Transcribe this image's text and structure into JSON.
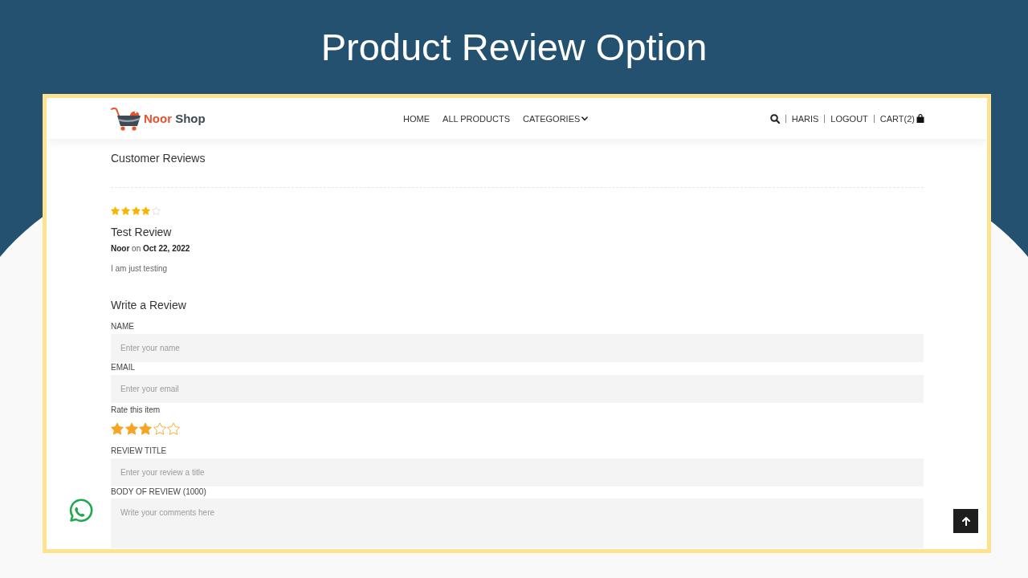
{
  "slide": {
    "title": "Product Review Option"
  },
  "navbar": {
    "brand": {
      "first": "Noor",
      "second": "Shop"
    },
    "menu": [
      {
        "kind": "link",
        "label": "HOME"
      },
      {
        "kind": "link",
        "label": "ALL PRODUCTS"
      },
      {
        "kind": "dropdown",
        "label": "CATEGORIES"
      }
    ],
    "account": [
      {
        "kind": "search"
      },
      {
        "kind": "link",
        "label": "HARIS"
      },
      {
        "kind": "link",
        "label": "LOGOUT"
      },
      {
        "kind": "cart",
        "label": "CART(2)"
      }
    ]
  },
  "customer_reviews": {
    "heading": "Customer Reviews",
    "reviews": [
      {
        "stars": 4,
        "title": "Test Review",
        "byline": "**Noor** on **Oct 22, 2022**",
        "body": "I am just testing"
      }
    ]
  },
  "write_review": {
    "heading": "Write a Review",
    "fields": [
      {
        "kind": "input",
        "label": "NAME",
        "placeholder": "Enter your name"
      },
      {
        "kind": "input",
        "label": "EMAIL",
        "placeholder": "Enter your email"
      },
      {
        "kind": "rating",
        "label": "Rate this item",
        "stars": 3
      },
      {
        "kind": "input",
        "label": "REVIEW TITLE",
        "placeholder": "Enter your review a title"
      },
      {
        "kind": "textarea",
        "label": "BODY OF REVIEW (1000)",
        "placeholder": "Write your comments here"
      }
    ]
  }
}
